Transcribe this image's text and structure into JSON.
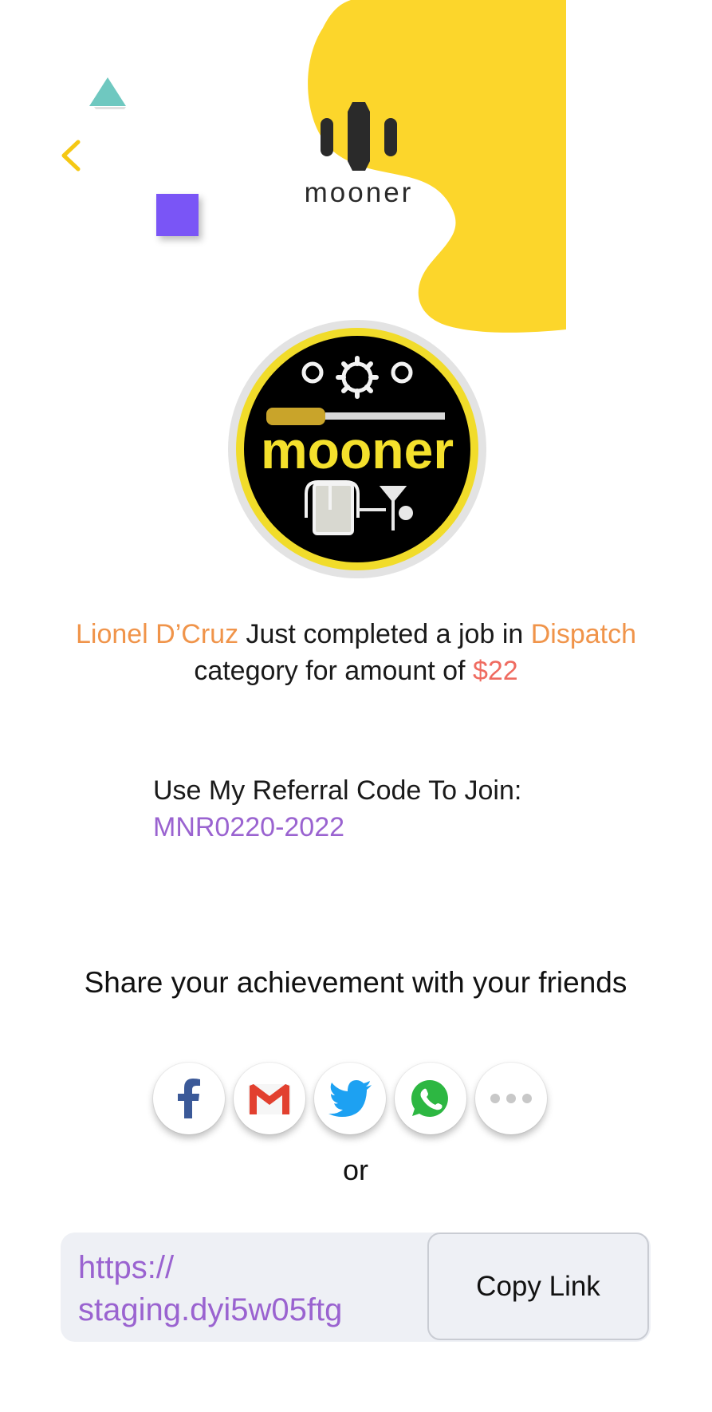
{
  "brand": {
    "name": "mooner",
    "accent_yellow": "#fcd62b",
    "purple": "#7a55f6",
    "teal": "#6fc8c0"
  },
  "badge": {
    "text": "mooner"
  },
  "achievement": {
    "user_name": "Lionel D’Cruz",
    "middle_text": " Just completed a job in ",
    "category": "Dispatch",
    "suffix_text": " category for amount of ",
    "amount": "$22"
  },
  "referral": {
    "label": "Use My Referral Code To Join:",
    "code": "MNR0220-2022"
  },
  "share": {
    "title": "Share your achievement with your friends",
    "buttons": [
      {
        "icon": "facebook-icon"
      },
      {
        "icon": "gmail-icon"
      },
      {
        "icon": "twitter-icon"
      },
      {
        "icon": "whatsapp-icon"
      },
      {
        "icon": "more-icon"
      }
    ],
    "or_text": "or"
  },
  "link": {
    "url": "https://\nstaging.dyi5w05ftg",
    "copy_label": "Copy Link"
  }
}
